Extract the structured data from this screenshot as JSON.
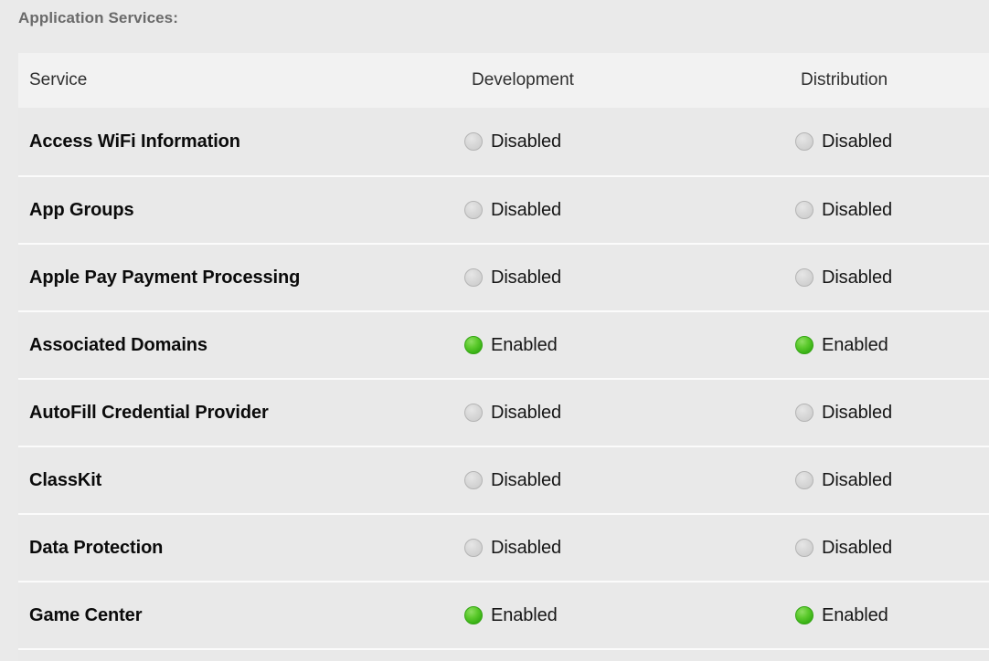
{
  "section": {
    "title": "Application Services:"
  },
  "table": {
    "columns": [
      {
        "key": "service",
        "label": "Service"
      },
      {
        "key": "development",
        "label": "Development"
      },
      {
        "key": "distribution",
        "label": "Distribution"
      }
    ],
    "status_labels": {
      "enabled": "Enabled",
      "disabled": "Disabled"
    },
    "colors": {
      "page_background": "#eaeaea",
      "header_background": "#f2f2f2",
      "row_background": "#e9e9e9",
      "row_separator": "#fbfbfb",
      "title_text": "#6a6a6a",
      "service_text": "#0b0b0b",
      "status_text": "#161616",
      "enabled_dot": "#3eb81a",
      "disabled_dot": "#d0d0d0"
    },
    "rows": [
      {
        "service": "Access WiFi Information",
        "development": "Disabled",
        "distribution": "Disabled"
      },
      {
        "service": "App Groups",
        "development": "Disabled",
        "distribution": "Disabled"
      },
      {
        "service": "Apple Pay Payment Processing",
        "development": "Disabled",
        "distribution": "Disabled"
      },
      {
        "service": "Associated Domains",
        "development": "Enabled",
        "distribution": "Enabled"
      },
      {
        "service": "AutoFill Credential Provider",
        "development": "Disabled",
        "distribution": "Disabled"
      },
      {
        "service": "ClassKit",
        "development": "Disabled",
        "distribution": "Disabled"
      },
      {
        "service": "Data Protection",
        "development": "Disabled",
        "distribution": "Disabled"
      },
      {
        "service": "Game Center",
        "development": "Enabled",
        "distribution": "Enabled"
      }
    ]
  }
}
